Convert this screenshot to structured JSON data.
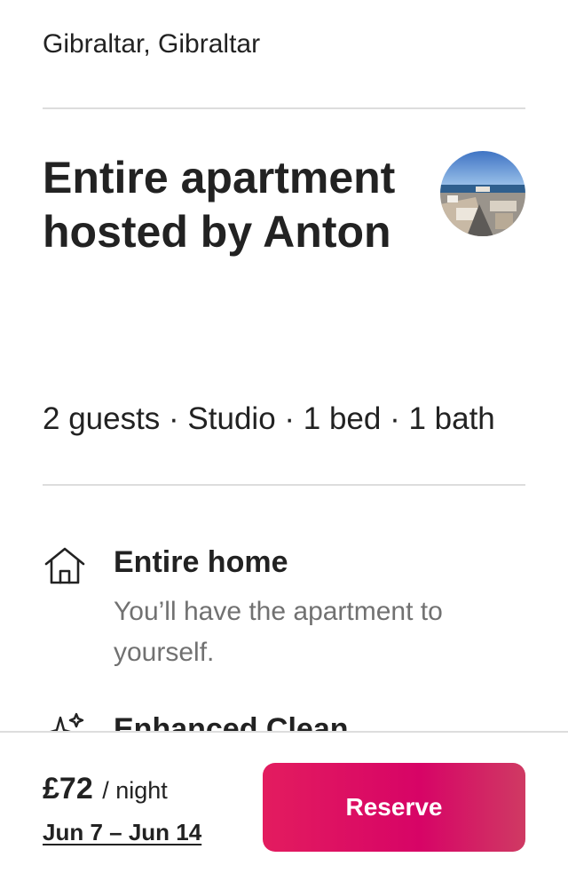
{
  "listing": {
    "location": "Gibraltar, Gibraltar",
    "title": "Entire apartment hosted by Anton",
    "details": "2 guests · Studio · 1 bed · 1 bath"
  },
  "highlights": [
    {
      "icon": "home-icon",
      "title": "Entire home",
      "description": "You’ll have the apartment to yourself."
    },
    {
      "icon": "sparkles-icon",
      "title": "Enhanced Clean"
    }
  ],
  "footer": {
    "price": "£72",
    "per_night": "/ night",
    "dates": "Jun 7 – Jun 14",
    "reserve_label": "Reserve"
  },
  "colors": {
    "accent": "#e31c5f",
    "text": "#222222",
    "secondary_text": "#717171",
    "divider": "#dddddd"
  }
}
